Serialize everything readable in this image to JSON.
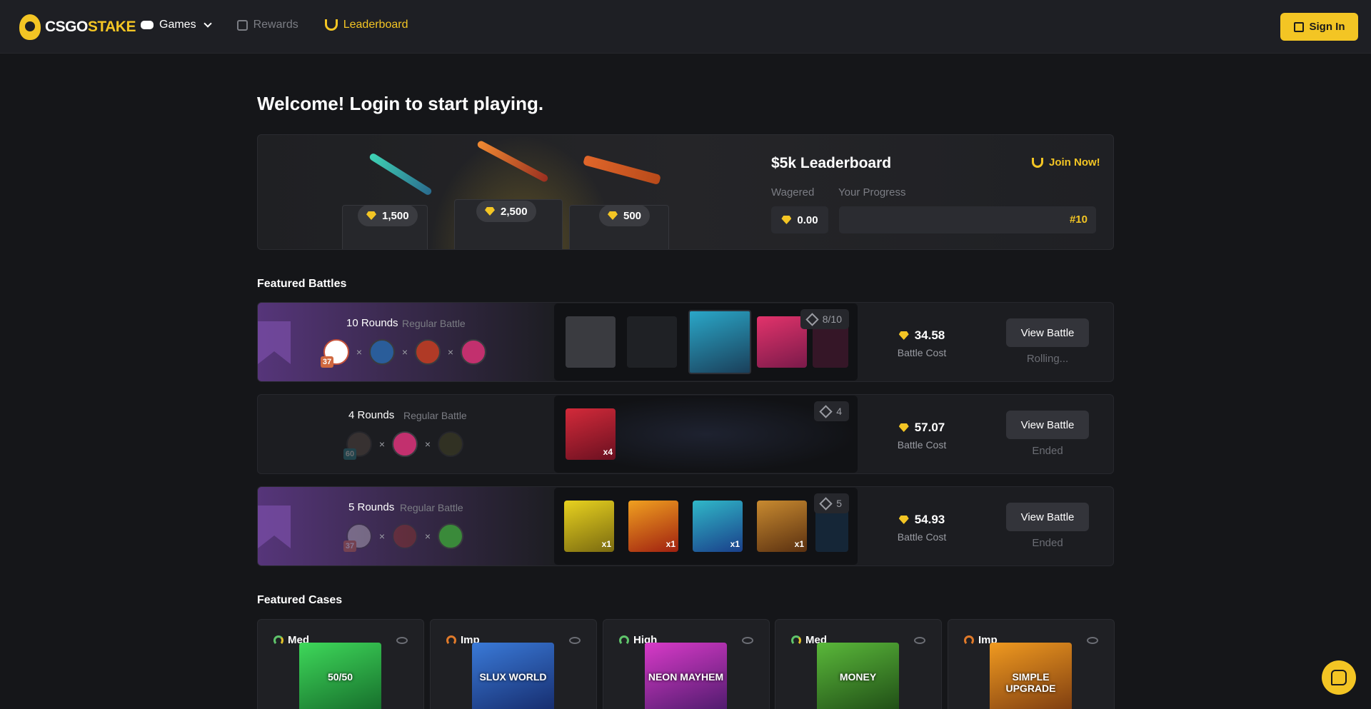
{
  "brand": {
    "logo_left": "CSGO",
    "logo_right": "STAKE"
  },
  "nav": {
    "games": "Games",
    "rewards": "Rewards",
    "leaderboard": "Leaderboard",
    "signin": "Sign In"
  },
  "headline": "Welcome! Login to start playing.",
  "leaderboard": {
    "title": "$5k Leaderboard",
    "join": "Join Now!",
    "wagered_label": "Wagered",
    "progress_label": "Your Progress",
    "wagered_value": "0.00",
    "rank": "#10",
    "progress_fraction": 0,
    "prizes": [
      "1,500",
      "2,500",
      "500"
    ]
  },
  "battles_title": "Featured Battles",
  "battles": [
    {
      "rounds": "10 Rounds",
      "type": "Regular Battle",
      "level": "37",
      "count": "8/10",
      "cost": "34.58",
      "cost_label": "Battle Cost",
      "button": "View Battle",
      "status": "Rolling..."
    },
    {
      "rounds": "4 Rounds",
      "type": "Regular Battle",
      "level": "60",
      "count": "4",
      "cost": "57.07",
      "cost_label": "Battle Cost",
      "button": "View Battle",
      "status": "Ended",
      "cases": [
        "x4"
      ]
    },
    {
      "rounds": "5 Rounds",
      "type": "Regular Battle",
      "level": "37",
      "count": "5",
      "cost": "54.93",
      "cost_label": "Battle Cost",
      "button": "View Battle",
      "status": "Ended",
      "cases": [
        "x1",
        "x1",
        "x1",
        "x1"
      ]
    }
  ],
  "cases_title": "Featured Cases",
  "cases": [
    {
      "risk": "Med",
      "name": "50/50"
    },
    {
      "risk": "Imp",
      "name": "SLUX WORLD"
    },
    {
      "risk": "High",
      "name": "NEON MAYHEM"
    },
    {
      "risk": "Med",
      "name": "MONEY"
    },
    {
      "risk": "Imp",
      "name": "SIMPLE UPGRADE"
    }
  ],
  "colors": {
    "accent": "#f3c524",
    "purple": "#56357a",
    "background": "#151619"
  }
}
